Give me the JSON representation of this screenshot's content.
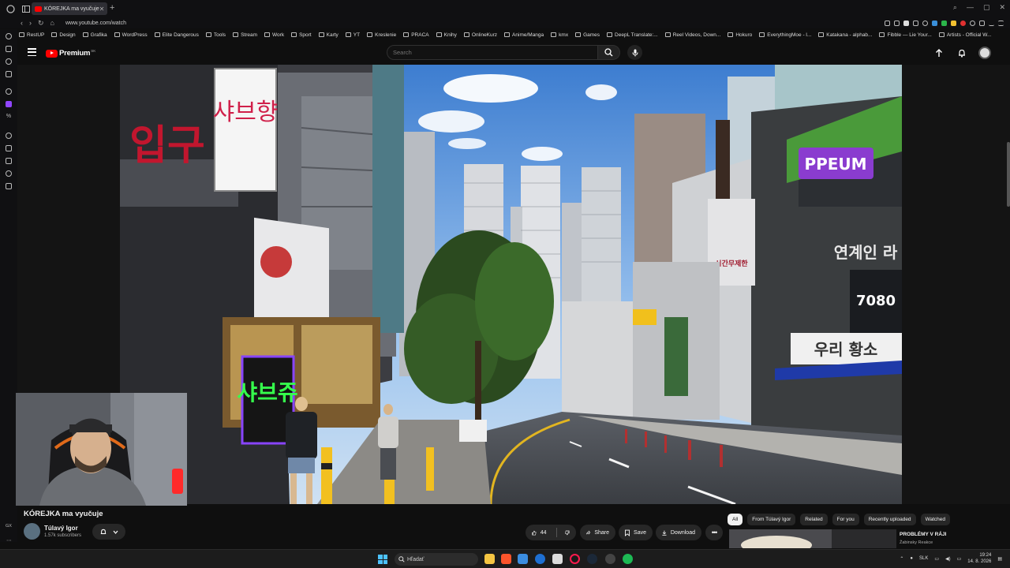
{
  "browser": {
    "tab_title": "KÓREJKA ma vyučuje",
    "url": "www.youtube.com/watch",
    "bookmarks": [
      "RestUP",
      "Design",
      "Grafika",
      "WordPress",
      "Elite Dangerous",
      "Tools",
      "Stream",
      "Work",
      "Sport",
      "Karty",
      "YT",
      "Kreslenie",
      "PRACA",
      "Knihy",
      "OnlineKurz",
      "Anime/Manga",
      "kmx",
      "Games",
      "DeepL Translate:...",
      "Reel Videos, Down...",
      "Hokuro",
      "EverythingMoe - l...",
      "Katakana - alphab...",
      "Fibble — Lie Your...",
      "Artists - Official W..."
    ]
  },
  "youtube": {
    "brand": "Premium",
    "country": "SK",
    "search_placeholder": "Search"
  },
  "video": {
    "title": "KÓREJKA ma vyučuje",
    "channel": "Túlavý Igor",
    "subscribers": "1.57k subscribers",
    "likes": "44",
    "share_label": "Share",
    "save_label": "Save",
    "download_label": "Download"
  },
  "scene_signs": {
    "sign1": "샤브향",
    "sign2": "입구",
    "sign3": "샤브쥬",
    "sign4": "PPEUM",
    "sign5": "7080",
    "sign6": "우리 황소",
    "sign7": "시간무제한",
    "sign8": "연계인 라"
  },
  "chips": [
    "All",
    "From Túlavý Igor",
    "Related",
    "For you",
    "Recently uploaded",
    "Watched"
  ],
  "recommendation": {
    "title": "PROBLÉMY V RÁJI",
    "channel": "Žabinsky Reakce"
  },
  "taskbar": {
    "search_placeholder": "Hľadať",
    "language": "SLK",
    "time": "19:24",
    "date": "14. 8. 2026"
  },
  "colors": {
    "yt_red": "#ff0000",
    "background": "#0f0f0f",
    "chip_active": "#f1f1f1",
    "accent_blue": "#4cc2ff"
  }
}
